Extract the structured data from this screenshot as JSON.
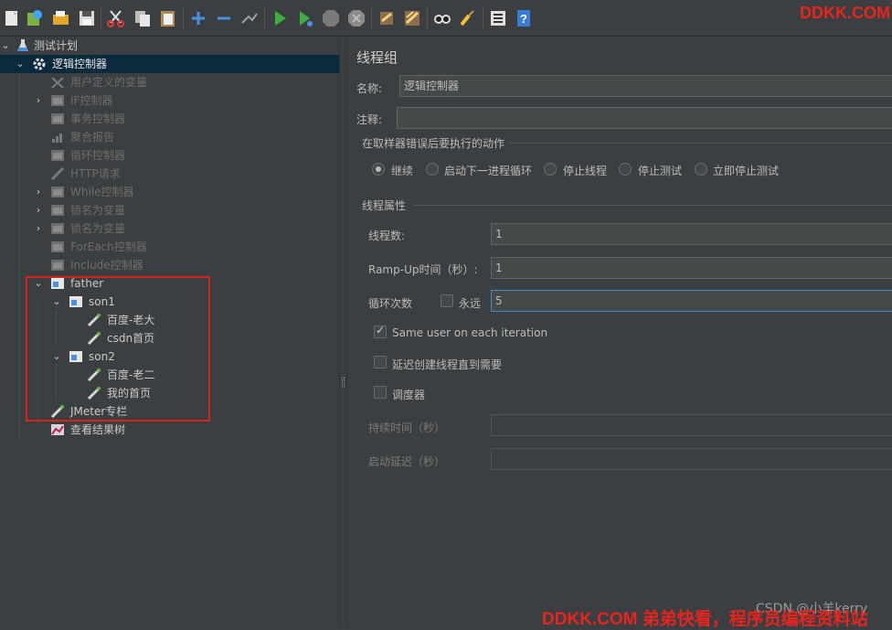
{
  "toolbar": {
    "buttons": [
      "new-icon",
      "templates-icon",
      "open-icon",
      "save-icon",
      "cut-icon",
      "copy-icon",
      "paste-icon",
      "expand-icon",
      "collapse-icon",
      "toggle-icon",
      "start-icon",
      "start-no-pause-icon",
      "stop-icon",
      "shutdown-icon",
      "clear-icon",
      "clear-all-icon",
      "search-icon",
      "reset-search-icon",
      "function-helper-icon",
      "help-icon"
    ],
    "watermark": "DDKK.COM"
  },
  "tree": {
    "root": "测试计划",
    "controller": "逻辑控制器",
    "items": [
      {
        "label": "用户定义的变量",
        "icon": "tools-icon"
      },
      {
        "label": "IF控制器",
        "icon": "controller-icon",
        "expandable": true
      },
      {
        "label": "事务控制器",
        "icon": "controller-icon"
      },
      {
        "label": "聚合报告",
        "icon": "report-icon"
      },
      {
        "label": "循环控制器",
        "icon": "controller-icon"
      },
      {
        "label": "HTTP请求",
        "icon": "sampler-icon"
      },
      {
        "label": "While控制器",
        "icon": "controller-icon",
        "expandable": true
      },
      {
        "label": "锁名为变量",
        "icon": "controller-icon",
        "expandable": true
      },
      {
        "label": "锁名为变量",
        "icon": "controller-icon",
        "expandable": true
      },
      {
        "label": "ForEach控制器",
        "icon": "controller-icon"
      },
      {
        "label": "Include控制器",
        "icon": "controller-icon"
      }
    ],
    "father": "father",
    "son1": "son1",
    "son1_children": [
      "百度-老大",
      "csdn首页"
    ],
    "son2": "son2",
    "son2_children": [
      "百度-老二",
      "我的首页"
    ],
    "jmeter_column": "JMeter专栏",
    "result_tree": "查看结果树"
  },
  "panel": {
    "title": "线程组",
    "name_label": "名称:",
    "name_value": "逻辑控制器",
    "comment_label": "注释:",
    "comment_value": "",
    "error_action_title": "在取样器错误后要执行的动作",
    "error_actions": [
      "继续",
      "启动下一进程循环",
      "停止线程",
      "停止测试",
      "立即停止测试"
    ],
    "error_action_selected": "继续",
    "thread_props_title": "线程属性",
    "threads_label": "线程数:",
    "threads_value": "1",
    "rampup_label": "Ramp-Up时间（秒）:",
    "rampup_value": "1",
    "loop_label": "循环次数",
    "forever_label": "永远",
    "forever_checked": false,
    "loop_value": "5",
    "same_user_label": "Same user on each iteration",
    "same_user_checked": true,
    "delay_label": "延迟创建线程直到需要",
    "delay_checked": false,
    "scheduler_label": "调度器",
    "scheduler_checked": false,
    "duration_label": "持续时间（秒）",
    "duration_value": "",
    "startup_delay_label": "启动延迟（秒）",
    "startup_delay_value": ""
  },
  "footer": {
    "csdn": "CSDN @小羊kerry",
    "watermark": "DDKK.COM 弟弟快看，程序员编程资料站"
  }
}
